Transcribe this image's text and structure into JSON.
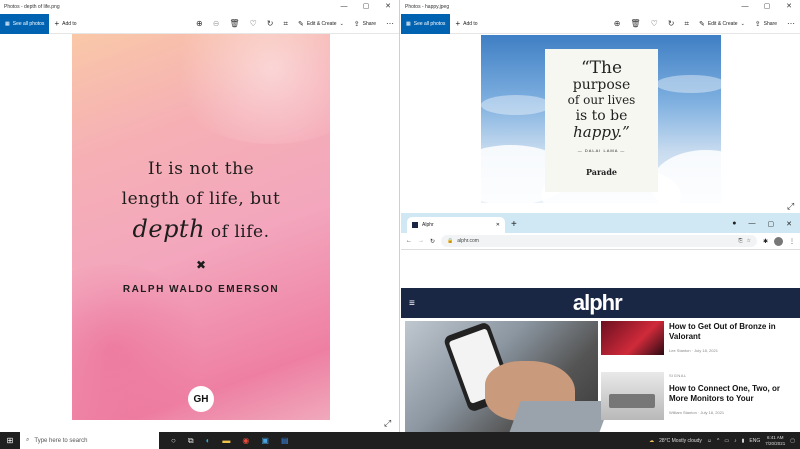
{
  "taskbar": {
    "search_placeholder": "Type here to search",
    "weather": "28°C  Mostly cloudy",
    "time": "6:41 AM",
    "date": "7/20/2021"
  },
  "left_window": {
    "title": "Photos - depth of life.png",
    "see_all": "See all photos",
    "add_to": "Add to",
    "edit_create": "Edit & Create",
    "share": "Share",
    "quote_line1": "It is not the",
    "quote_line2": "length of life, but",
    "quote_depth": "depth",
    "quote_line3_end": " of life.",
    "author": "RALPH WALDO EMERSON",
    "badge": "GH"
  },
  "right_window": {
    "title": "Photos - happy.jpeg",
    "see_all": "See all photos",
    "add_to": "Add to",
    "edit_create": "Edit & Create",
    "share": "Share",
    "quote_line1": "“The",
    "quote_line2": "purpose",
    "quote_line3": "of our lives",
    "quote_line4": "is to be",
    "quote_line5": "happy.”",
    "attribution": "— DALAI LAMA —",
    "brand": "Parade"
  },
  "browser": {
    "tab_title": "Alphr",
    "url": "alphr.com",
    "logo": "alphr",
    "articles": [
      {
        "title": "How to Get Out of Bronze in Valorant",
        "author": "Lee Stanton",
        "date": "July 18, 2021"
      },
      {
        "category": "SIGNAL",
        "title": "How to Connect One, Two, or More Monitors to Your",
        "author": "William Stanton",
        "date": "July 18, 2021"
      }
    ]
  }
}
